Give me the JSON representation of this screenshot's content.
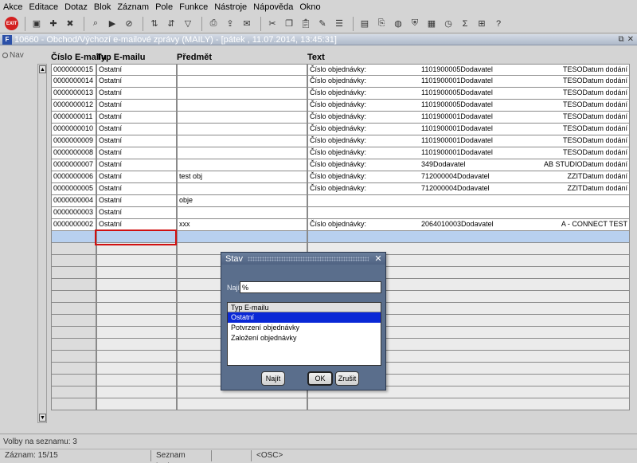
{
  "menu": [
    "Akce",
    "Editace",
    "Dotaz",
    "Blok",
    "Záznam",
    "Pole",
    "Funkce",
    "Nástroje",
    "Nápověda",
    "Okno"
  ],
  "toolbar": {
    "exit_label": "EXIT"
  },
  "window": {
    "title": "10660 - Obchod/Výchozí e-mailové zprávy (MAILY) - [pátek , 11.07.2014, 13:45:31]",
    "nav_label": "Nav"
  },
  "columns": {
    "num": "Číslo E-mailu",
    "type": "Typ E-mailu",
    "subject": "Předmět",
    "text": "Text"
  },
  "rows": [
    {
      "num": "0000000015",
      "type": "Ostatní",
      "subject": "",
      "text_a": "Číslo objednávky:",
      "text_b": "1101900005Dodavatel",
      "text_c": "TESODatum dodání"
    },
    {
      "num": "0000000014",
      "type": "Ostatní",
      "subject": "",
      "text_a": "Číslo objednávky:",
      "text_b": "1101900001Dodavatel",
      "text_c": "TESODatum dodání"
    },
    {
      "num": "0000000013",
      "type": "Ostatní",
      "subject": "",
      "text_a": "Číslo objednávky:",
      "text_b": "1101900005Dodavatel",
      "text_c": "TESODatum dodání"
    },
    {
      "num": "0000000012",
      "type": "Ostatní",
      "subject": "",
      "text_a": "Číslo objednávky:",
      "text_b": "1101900005Dodavatel",
      "text_c": "TESODatum dodání"
    },
    {
      "num": "0000000011",
      "type": "Ostatní",
      "subject": "",
      "text_a": "Číslo objednávky:",
      "text_b": "1101900001Dodavatel",
      "text_c": "TESODatum dodání"
    },
    {
      "num": "0000000010",
      "type": "Ostatní",
      "subject": "",
      "text_a": "Číslo objednávky:",
      "text_b": "1101900001Dodavatel",
      "text_c": "TESODatum dodání"
    },
    {
      "num": "0000000009",
      "type": "Ostatní",
      "subject": "",
      "text_a": "Číslo objednávky:",
      "text_b": "1101900001Dodavatel",
      "text_c": "TESODatum dodání"
    },
    {
      "num": "0000000008",
      "type": "Ostatní",
      "subject": "",
      "text_a": "Číslo objednávky:",
      "text_b": "1101900001Dodavatel",
      "text_c": "TESODatum dodání"
    },
    {
      "num": "0000000007",
      "type": "Ostatní",
      "subject": "",
      "text_a": "Číslo objednávky:",
      "text_b": "349Dodavatel",
      "text_c": "AB STUDIODatum dodání"
    },
    {
      "num": "0000000006",
      "type": "Ostatní",
      "subject": "test obj",
      "text_a": "Číslo objednávky:",
      "text_b": "712000004Dodavatel",
      "text_c": "ZZITDatum dodání"
    },
    {
      "num": "0000000005",
      "type": "Ostatní",
      "subject": "",
      "text_a": "Číslo objednávky:",
      "text_b": "712000004Dodavatel",
      "text_c": "ZZITDatum dodání"
    },
    {
      "num": "0000000004",
      "type": "Ostatní",
      "subject": "obje",
      "text_a": "",
      "text_b": "",
      "text_c": ""
    },
    {
      "num": "0000000003",
      "type": "Ostatní",
      "subject": "",
      "text_a": "",
      "text_b": "",
      "text_c": ""
    },
    {
      "num": "0000000002",
      "type": "Ostatní",
      "subject": "xxx",
      "text_a": "Číslo objednávky:",
      "text_b": "2064010003Dodavatel",
      "text_c": "A - CONNECT TEST"
    }
  ],
  "dialog": {
    "title": "Stav",
    "find_label": "Najít",
    "find_value": "%",
    "list_header": "Typ E-mailu",
    "options": [
      "Ostatní",
      "Potvrzení objednávky",
      "Založení objednávky"
    ],
    "selected_index": 0,
    "find_button": "Najít",
    "ok_button": "OK",
    "cancel_button": "Zrušit"
  },
  "status": {
    "hint": "Volby na seznamu: 3",
    "record": "Záznam: 15/15",
    "list_values": "Seznam hodn...",
    "osc": "<OSC>"
  }
}
